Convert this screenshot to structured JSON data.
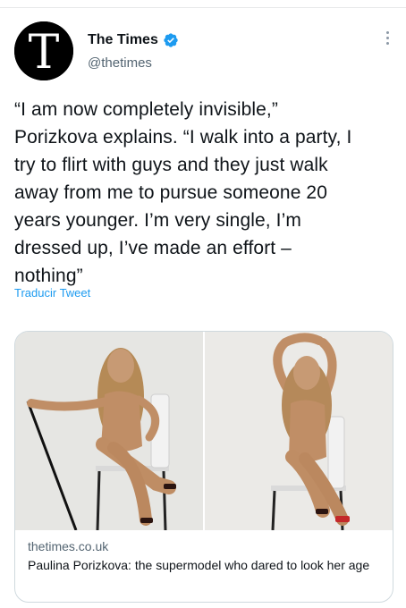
{
  "author": {
    "name": "The Times",
    "handle": "@thetimes",
    "avatar_letter": "T",
    "verified_icon": "verified-badge-icon",
    "more_icon": "more-options-icon"
  },
  "tweet": {
    "text": "“I am now completely invisible,”\nPorizkova explains. “I walk into a party, I\ntry to flirt with guys and they just walk\naway from me to pursue someone 20\nyears younger. I’m very single, I’m\ndressed up, I’ve made an effort –\nnothing”",
    "translate_label": "Traducir Tweet"
  },
  "card": {
    "domain": "thetimes.co.uk",
    "title": "Paulina Porizkova: the supermodel who dared to look her age"
  },
  "colors": {
    "accent": "#1d9bf0",
    "secondary_text": "#536471",
    "border": "#cfd9de"
  }
}
